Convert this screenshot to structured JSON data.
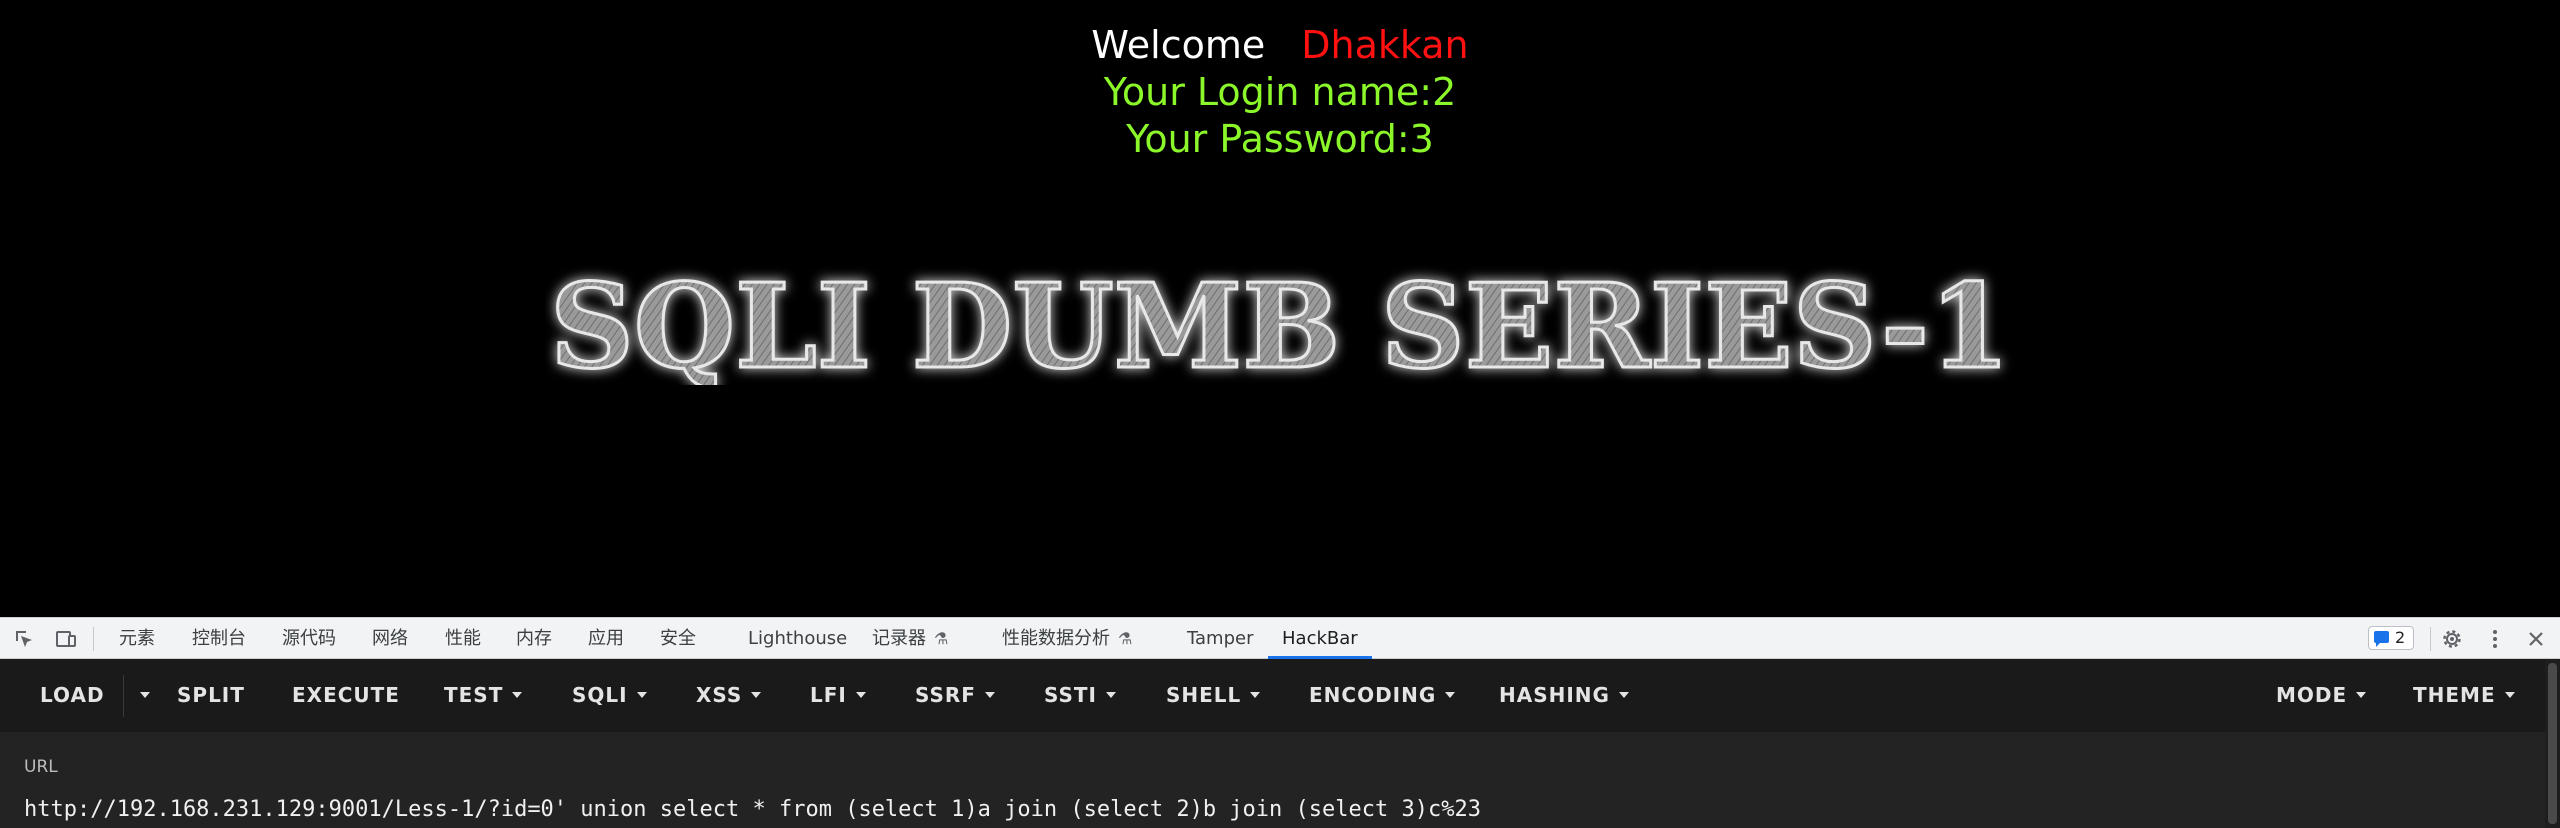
{
  "page": {
    "welcome": "Welcome",
    "user": "Dhakkan",
    "login_line": "Your Login name:2",
    "password_line": "Your Password:3",
    "banner": "SQLI DUMB SERIES-1"
  },
  "devtools": {
    "tabs": [
      "元素",
      "控制台",
      "源代码",
      "网络",
      "性能",
      "内存",
      "应用",
      "安全",
      "Lighthouse",
      "记录器",
      "性能数据分析",
      "Tamper",
      "HackBar"
    ],
    "active_tab": "HackBar",
    "issues_count": "2",
    "icons": [
      "inspect-icon",
      "device-toolbar-icon",
      "flask-icon",
      "issues-icon",
      "gear-icon",
      "more-icon",
      "close-icon"
    ],
    "accent": "#1a73e8"
  },
  "hackbar": {
    "load": "LOAD",
    "split": "SPLIT",
    "execute": "EXECUTE",
    "test": "TEST",
    "sqli": "SQLI",
    "xss": "XSS",
    "lfi": "LFI",
    "ssrf": "SSRF",
    "ssti": "SSTI",
    "shell": "SHELL",
    "encoding": "ENCODING",
    "hashing": "HASHING",
    "mode": "MODE",
    "theme": "THEME",
    "url_label": "URL",
    "url_value": "http://192.168.231.129:9001/Less-1/?id=0' union select * from (select 1)a join (select 2)b join (select 3)c%23"
  },
  "colors": {
    "page_bg": "#000000",
    "welcome_text": "#ffffff",
    "user_name": "#ff1111",
    "green_text": "#8bf72a",
    "hackbar_bg": "#1a1a1a"
  }
}
